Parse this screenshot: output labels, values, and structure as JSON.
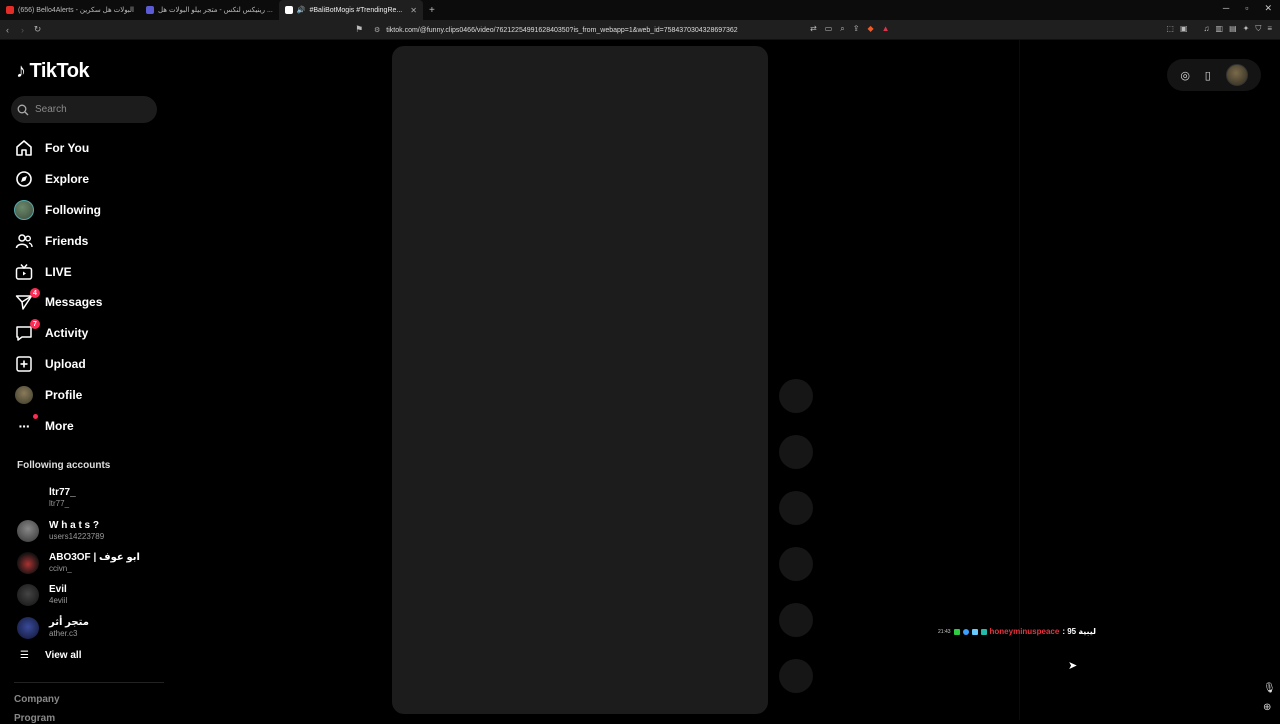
{
  "browser": {
    "tabs": [
      {
        "label": "(656) Bello4Alerts - البولات هل سكرين",
        "favicon_color": "#e52d27",
        "active": false
      },
      {
        "label": "رينيكس لنكس - متجر بيلو البولات هل ...",
        "favicon_color": "#5b5bd6",
        "active": false
      },
      {
        "label": "#BaliBotMogis #TrendingRe...",
        "favicon_color": "#ffffff",
        "active": true
      }
    ],
    "new_tab": "+",
    "url": "tiktok.com/@funny.clips0466/video/7621225499162840350?is_from_webapp=1&web_id=7584370304328697362"
  },
  "sidebar": {
    "logo": "TikTok",
    "search_placeholder": "Search",
    "nav": [
      {
        "label": "For You",
        "icon": "home-icon"
      },
      {
        "label": "Explore",
        "icon": "compass-icon"
      },
      {
        "label": "Following",
        "icon": "following-avatar"
      },
      {
        "label": "Friends",
        "icon": "friends-icon"
      },
      {
        "label": "LIVE",
        "icon": "live-icon"
      },
      {
        "label": "Messages",
        "icon": "send-icon",
        "badge": "4"
      },
      {
        "label": "Activity",
        "icon": "activity-icon",
        "badge": "7"
      },
      {
        "label": "Upload",
        "icon": "upload-icon"
      },
      {
        "label": "Profile",
        "icon": "profile-avatar"
      },
      {
        "label": "More",
        "icon": "more-icon"
      }
    ],
    "following_title": "Following accounts",
    "accounts": [
      {
        "name": "ltr77_",
        "handle": "ltr77_",
        "color": "#000000"
      },
      {
        "name": "W h a t s ?",
        "handle": "users14223789",
        "color": "#5a5a5a"
      },
      {
        "name": "ABO3OF | ابو عوف",
        "handle": "ccivn_",
        "color": "#2a1a1a"
      },
      {
        "name": "Evil",
        "handle": "4eviil",
        "color": "#222222"
      },
      {
        "name": "متجر أثر",
        "handle": "ather.c3",
        "color": "#0e1430"
      }
    ],
    "view_all": "View all",
    "footer": [
      "Company",
      "Program"
    ]
  },
  "overlay": {
    "time": "21:43",
    "username": "honeyminuspeace",
    "message": ": ليبية 95"
  }
}
